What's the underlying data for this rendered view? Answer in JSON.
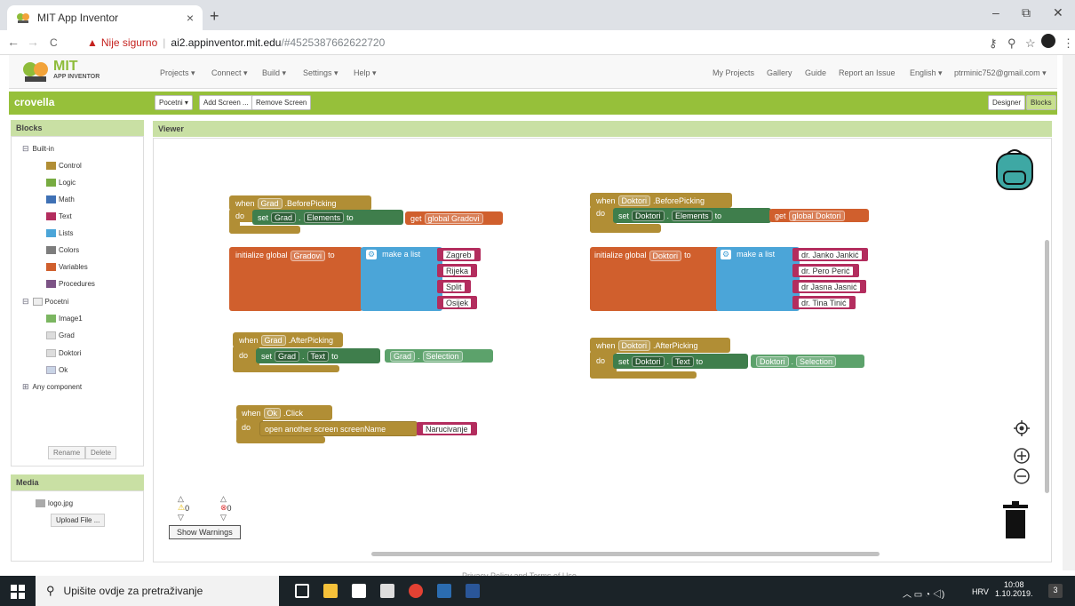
{
  "browser": {
    "tab_title": "MIT App Inventor",
    "tab_close": "×",
    "new_tab": "+",
    "win_min": "–",
    "win_max": "⧉",
    "win_close": "✕",
    "back": "←",
    "forward": "→",
    "reload": "C",
    "not_secure": "Nije sigurno",
    "url_host": "ai2.appinventor.mit.edu",
    "url_path": "/#4525387662622720",
    "icons": [
      "key-icon",
      "zoom-icon",
      "star-icon",
      "profile-icon",
      "menu-icon"
    ]
  },
  "app": {
    "logo_text": "MIT",
    "logo_sub": "APP INVENTOR",
    "menu_left": [
      "Projects ▾",
      "Connect ▾",
      "Build ▾",
      "Settings ▾",
      "Help ▾"
    ],
    "menu_right": [
      "My Projects",
      "Gallery",
      "Guide",
      "Report an Issue",
      "English ▾",
      "ptrminic752@gmail.com ▾"
    ],
    "project_name": "crovella",
    "screen_select": "Pocetni ▾",
    "add_screen": "Add Screen ...",
    "remove_screen": "Remove Screen",
    "designer": "Designer",
    "blocks_btn": "Blocks"
  },
  "blocks_panel": {
    "title": "Blocks",
    "builtin": "Built-in",
    "builtin_items": [
      {
        "label": "Control",
        "color": "#b18e35"
      },
      {
        "label": "Logic",
        "color": "#77ab41"
      },
      {
        "label": "Math",
        "color": "#3f71b5"
      },
      {
        "label": "Text",
        "color": "#b32d5e"
      },
      {
        "label": "Lists",
        "color": "#4ba5d8"
      },
      {
        "label": "Colors",
        "color": "#7d7d7d"
      },
      {
        "label": "Variables",
        "color": "#d05f2d"
      },
      {
        "label": "Procedures",
        "color": "#7c5385"
      }
    ],
    "screen": "Pocetni",
    "components": [
      "Image1",
      "Grad",
      "Doktori",
      "Ok"
    ],
    "any": "Any component",
    "rename": "Rename",
    "delete": "Delete"
  },
  "media": {
    "title": "Media",
    "file": "logo.jpg",
    "upload": "Upload File ..."
  },
  "viewer": {
    "title": "Viewer",
    "warnings_count": "0",
    "errors_count": "0",
    "show_warnings": "Show Warnings"
  },
  "code": {
    "when": "when",
    "do": "do",
    "set": "set",
    "to": "to",
    "get": "get",
    "init_global": "initialize global",
    "make_list": "make a list",
    "grad": "Grad",
    "doktori": "Doktori",
    "ok": "Ok",
    "before": ".BeforePicking",
    "after": ".AfterPicking",
    "click": ".Click",
    "elements": "Elements",
    "text": "Text",
    "selection": "Selection",
    "global_gradovi": "global Gradovi",
    "global_doktori": "global Doktori",
    "gradovi": "Gradovi",
    "doktori_var": "Doktori",
    "cities": [
      "Zagreb",
      "Rijeka",
      "Split",
      "Osijek"
    ],
    "doctors": [
      "dr. Janko Jankić",
      "dr. Pero Perić",
      "dr Jasna Jasnić",
      "dr. Tina Tinić"
    ],
    "open_screen": "open another screen  screenName",
    "screen_name": "Narucivanje"
  },
  "footer": "Privacy Policy and Terms of Use",
  "taskbar": {
    "search": "Upišite ovdje za pretraživanje",
    "lang": "HRV",
    "time": "10:08",
    "date": "1.10.2019.",
    "notif": "3"
  }
}
